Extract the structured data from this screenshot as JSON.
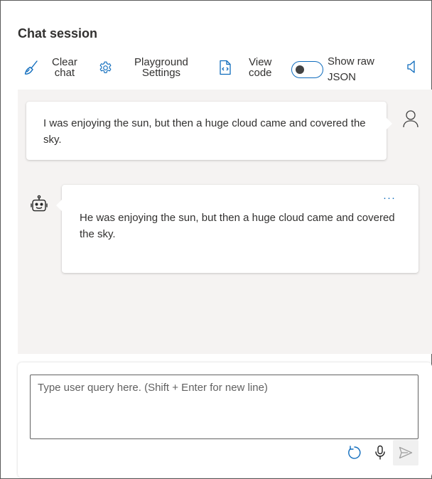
{
  "page": {
    "title": "Chat session"
  },
  "toolbar": {
    "clear_chat_line1": "Clear",
    "clear_chat_line2": "chat",
    "playground_line1": "Playground",
    "playground_line2": "Settings",
    "view_code_line1": "View",
    "view_code_line2": "code",
    "show_raw_line1": "Show raw",
    "show_raw_line2": "JSON",
    "show_raw_json_enabled": false
  },
  "messages": [
    {
      "role": "user",
      "text": "I was enjoying the sun, but then a huge cloud came and covered the sky."
    },
    {
      "role": "assistant",
      "text": "He was enjoying the sun, but then a huge cloud came and covered the sky."
    }
  ],
  "message_actions": {
    "more_label": "···"
  },
  "input": {
    "placeholder": "Type user query here. (Shift + Enter for new line)",
    "value": ""
  },
  "colors": {
    "accent": "#0f6cbd",
    "chat_background": "#f5f3f2",
    "text": "#323130"
  },
  "icons": {
    "clear_chat": "broom-icon",
    "playground_settings": "gear-icon",
    "view_code": "code-file-icon",
    "speaker": "speaker-icon",
    "user_avatar": "person-icon",
    "assistant_avatar": "bot-icon",
    "regenerate": "refresh-icon",
    "microphone": "microphone-icon",
    "send": "send-icon"
  }
}
